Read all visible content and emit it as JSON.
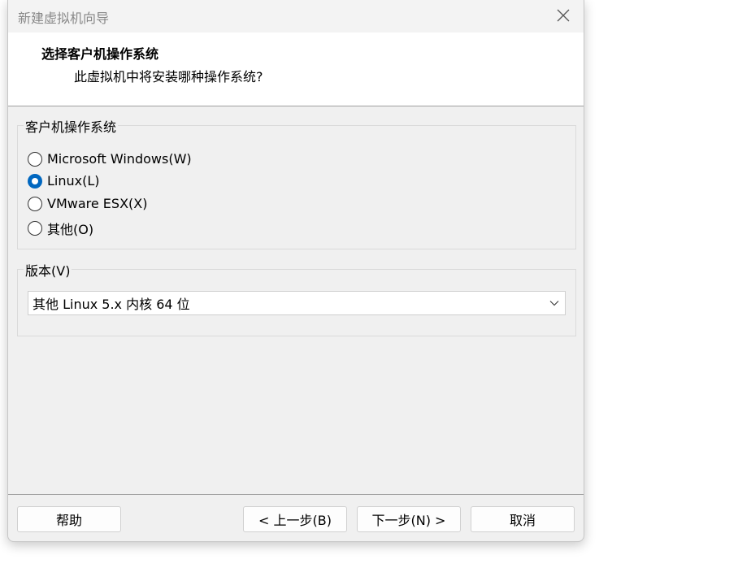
{
  "window": {
    "title": "新建虚拟机向导",
    "close_icon": "close-icon"
  },
  "header": {
    "title": "选择客户机操作系统",
    "subtitle": "此虚拟机中将安装哪种操作系统?"
  },
  "os_group": {
    "legend": "客户机操作系统",
    "options": [
      {
        "label": "Microsoft Windows(W)",
        "checked": false
      },
      {
        "label": "Linux(L)",
        "checked": true
      },
      {
        "label": "VMware ESX(X)",
        "checked": false
      },
      {
        "label": "其他(O)",
        "checked": false
      }
    ]
  },
  "version_group": {
    "legend": "版本(V)",
    "selected": "其他 Linux 5.x 内核 64 位",
    "arrow_icon": "chevron-down-icon"
  },
  "buttons": {
    "help": "帮助",
    "back": "< 上一步(B)",
    "next": "下一步(N) >",
    "cancel": "取消"
  },
  "colors": {
    "accent": "#0067c0"
  }
}
